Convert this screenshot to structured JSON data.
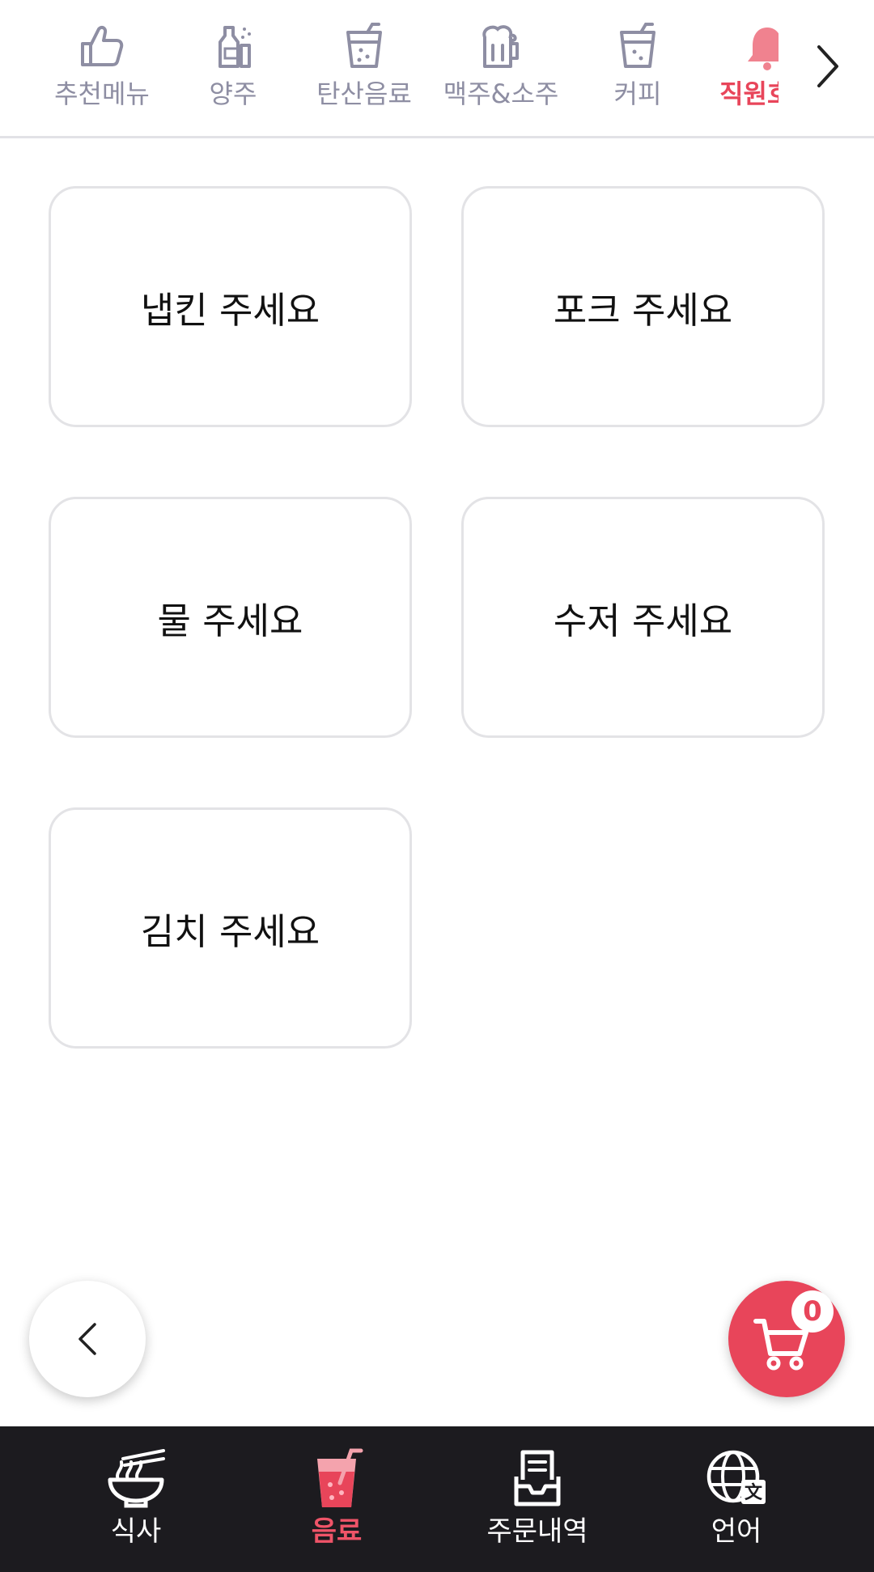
{
  "categories": [
    {
      "label": "추천메뉴",
      "icon": "thumbs-up-icon",
      "active": false
    },
    {
      "label": "양주",
      "icon": "liquor-bottle-icon",
      "active": false
    },
    {
      "label": "탄산음료",
      "icon": "soda-cup-icon",
      "active": false
    },
    {
      "label": "맥주&소주",
      "icon": "beer-mug-icon",
      "active": false
    },
    {
      "label": "커피",
      "icon": "coffee-cup-icon",
      "active": false
    },
    {
      "label": "직원호출",
      "icon": "bell-icon",
      "active": true
    }
  ],
  "requests": [
    {
      "label": "냅킨 주세요"
    },
    {
      "label": "포크 주세요"
    },
    {
      "label": "물 주세요"
    },
    {
      "label": "수저 주세요"
    },
    {
      "label": "김치 주세요"
    }
  ],
  "cart": {
    "count": "0"
  },
  "bottom_nav": [
    {
      "label": "식사",
      "icon": "noodle-bowl-icon",
      "active": false
    },
    {
      "label": "음료",
      "icon": "drink-cup-icon",
      "active": true
    },
    {
      "label": "주문내역",
      "icon": "order-tray-icon",
      "active": false
    },
    {
      "label": "언어",
      "icon": "globe-translate-icon",
      "active": false
    }
  ],
  "colors": {
    "accent": "#e8455a",
    "category_inactive": "#8e8ea3",
    "nav_background": "#1c1b1f",
    "card_border": "#e3e3e6"
  }
}
